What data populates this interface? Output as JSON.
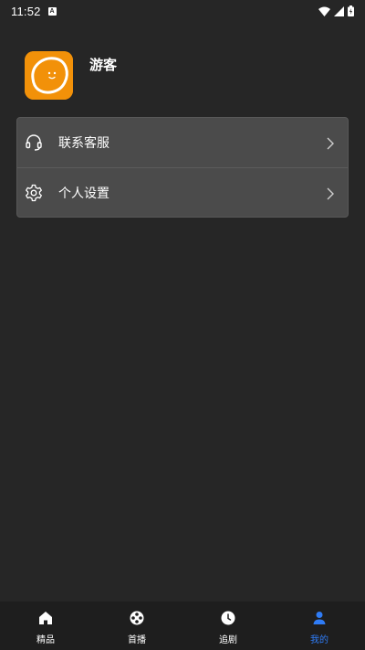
{
  "status_bar": {
    "time": "11:52",
    "notification_glyph": "A"
  },
  "profile": {
    "username": "游客",
    "avatar_color": "#f29109"
  },
  "menu": {
    "items": [
      {
        "label": "联系客服",
        "icon": "headset-icon"
      },
      {
        "label": "个人设置",
        "icon": "gear-icon"
      }
    ]
  },
  "bottom_nav": {
    "active_color": "#2f7cf6",
    "items": [
      {
        "label": "精品",
        "icon": "home-icon"
      },
      {
        "label": "首播",
        "icon": "film-reel-icon"
      },
      {
        "label": "追剧",
        "icon": "clock-icon"
      },
      {
        "label": "我的",
        "icon": "person-icon",
        "active": true
      }
    ]
  }
}
